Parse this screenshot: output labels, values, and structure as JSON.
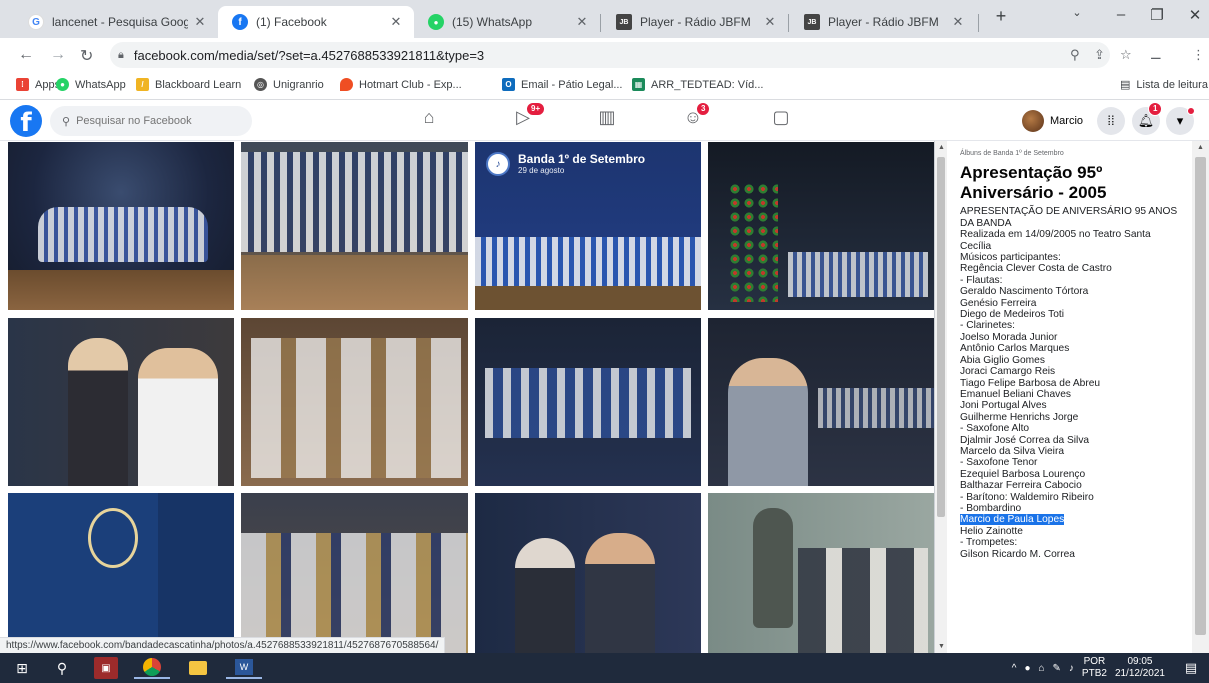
{
  "tabs": [
    {
      "title": "lancenet - Pesquisa Google",
      "favicon": "G"
    },
    {
      "title": "(1) Facebook",
      "favicon": "f"
    },
    {
      "title": "(15) WhatsApp",
      "favicon": "●"
    },
    {
      "title": "Player - Rádio JBFM",
      "favicon": "JBFM"
    },
    {
      "title": "Player - Rádio JBFM",
      "favicon": "JBFM"
    }
  ],
  "url": "facebook.com/media/set/?set=a.4527688533921811&type=3",
  "bookmarks": [
    "Apps",
    "WhatsApp",
    "Blackboard Learn",
    "Unigranrio",
    "Hotmart Club - Exp...",
    "Email - Pátio Legal...",
    "ARR_TEDTEAD: Víd..."
  ],
  "reading_list": "Lista de leitura",
  "facebook": {
    "search_placeholder": "Pesquisar no Facebook",
    "watch_badge": "9+",
    "groups_badge": "3",
    "notif_badge": "1",
    "profile_name": "Marcio"
  },
  "photo_tag": {
    "name": "Banda 1º de Setembro",
    "date": "29 de agosto"
  },
  "album": {
    "crumb": "Álbuns de Banda 1º de Setembro",
    "title_line1": "Apresentação 95º",
    "title_line2": "Aniversário - 2005",
    "lines": [
      "APRESENTAÇÃO DE ANIVERSÁRIO 95 ANOS",
      "DA BANDA",
      "Realizada em 14/09/2005 no Teatro Santa",
      "Cecília",
      "Músicos participantes:",
      "Regência Clever Costa de Castro",
      "- Flautas:",
      "Geraldo Nascimento Tórtora",
      "Genésio Ferreira",
      "Diego de Medeiros Toti",
      "- Clarinetes:",
      "Joelso Morada Junior",
      "Antônio Carlos Marques",
      "Abia Giglio Gomes",
      "Joraci Camargo Reis",
      "Tiago Felipe Barbosa de Abreu",
      "Emanuel Beliani Chaves",
      "Joni Portugal Alves",
      "Guilherme Henrichs Jorge",
      "- Saxofone Alto",
      "Djalmir José Correa da Silva",
      "Marcelo da Silva Vieira",
      "- Saxofone Tenor",
      "Ezequiel Barbosa Lourenço",
      "Balthazar Ferreira Cabocio",
      "- Barítono: Waldemiro Ribeiro",
      "- Bombardino",
      "Marcio de Paula Lopes",
      "Helio Zainotte",
      "- Trompetes:",
      "Gilson Ricardo M. Correa"
    ],
    "highlight": "Marcio de Paula Lopes"
  },
  "status_url": "https://www.facebook.com/bandadecascatinha/photos/a.4527688533921811/4527687670588564/",
  "taskbar": {
    "lang1": "POR",
    "lang2": "PTB2",
    "time": "09:05",
    "date": "21/12/2021"
  },
  "colors": {
    "fb_blue": "#1877f2",
    "badge_red": "#e41e3f",
    "taskbar": "#1f2a3c",
    "selection": "#1a73e8"
  }
}
